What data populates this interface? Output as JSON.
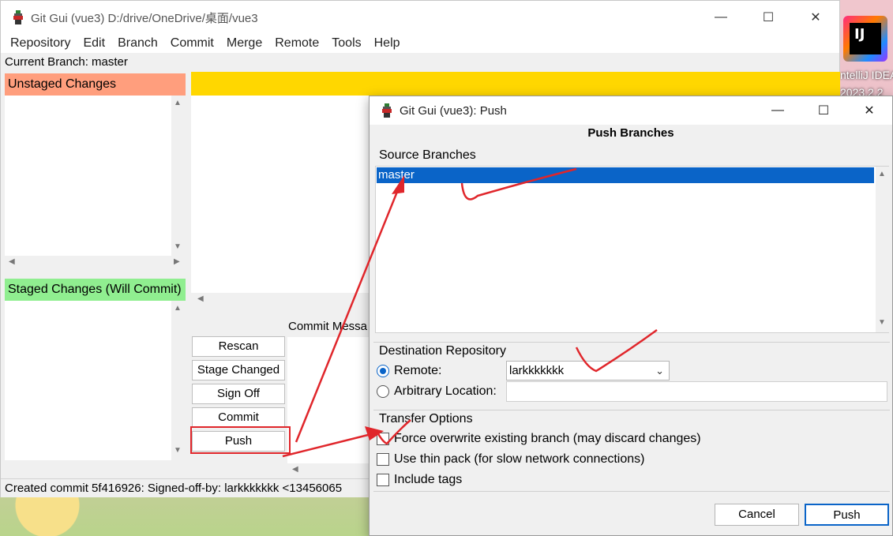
{
  "desktop": {
    "app_icon_text": "IJ",
    "app_label_line1": "ntelliJ IDEA",
    "app_label_line2": "2023.2.2"
  },
  "main_window": {
    "title": "Git Gui (vue3) D:/drive/OneDrive/桌面/vue3",
    "menu": [
      "Repository",
      "Edit",
      "Branch",
      "Commit",
      "Merge",
      "Remote",
      "Tools",
      "Help"
    ],
    "current_branch": "Current Branch: master",
    "unstaged_header": "Unstaged Changes",
    "staged_header": "Staged Changes (Will Commit)",
    "commit_message_label": "Commit Messa",
    "buttons": [
      "Rescan",
      "Stage Changed",
      "Sign Off",
      "Commit",
      "Push"
    ],
    "status": "Created commit 5f416926: Signed-off-by: larkkkkkkk <13456065"
  },
  "push_dialog": {
    "title": "Git Gui (vue3): Push",
    "heading": "Push Branches",
    "source_label": "Source Branches",
    "source_items": [
      "master"
    ],
    "dest_label": "Destination Repository",
    "remote_label": "Remote:",
    "remote_value": "larkkkkkkk",
    "arbitrary_label": "Arbitrary Location:",
    "transfer_label": "Transfer Options",
    "options": [
      "Force overwrite existing branch (may discard changes)",
      "Use thin pack (for slow network connections)",
      "Include tags"
    ],
    "cancel_label": "Cancel",
    "push_label": "Push"
  },
  "colors": {
    "unstaged": "#ff9e7d",
    "staged": "#90ee90",
    "diff_header": "#ffd700",
    "selection": "#0a64c8",
    "annotation": "#e0262b"
  }
}
